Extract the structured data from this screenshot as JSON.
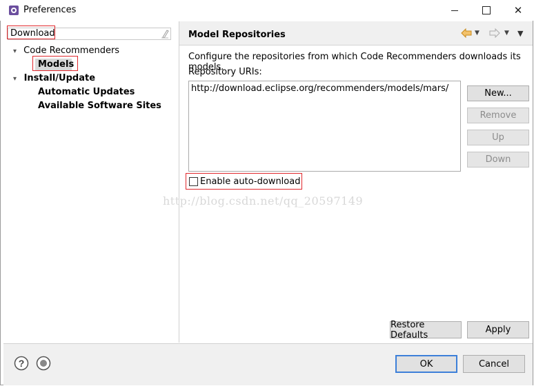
{
  "window": {
    "title": "Preferences"
  },
  "filter": {
    "value": "Download"
  },
  "tree": {
    "items": [
      {
        "label": "Code Recommenders",
        "twisty": "▾"
      },
      {
        "label": "Models"
      },
      {
        "label": "Install/Update",
        "twisty": "▾"
      },
      {
        "label": "Automatic Updates"
      },
      {
        "label": "Available Software Sites"
      }
    ]
  },
  "page": {
    "title": "Model Repositories",
    "description": "Configure the repositories from which Code Recommenders downloads its models.",
    "uris_label": "Repository URIs:",
    "uris": [
      "http://download.eclipse.org/recommenders/models/mars/"
    ],
    "buttons": {
      "new": "New...",
      "remove": "Remove",
      "up": "Up",
      "down": "Down"
    },
    "auto_download_label": "Enable auto-download",
    "auto_download_checked": false,
    "restore_defaults": "Restore Defaults",
    "apply": "Apply"
  },
  "watermark": "http://blog.csdn.net/qq_20597149",
  "dialog": {
    "ok": "OK",
    "cancel": "Cancel"
  },
  "icons": {
    "app": "eclipse-preferences-icon",
    "clear": "eraser-icon",
    "back": "back-arrow-icon",
    "forward": "forward-arrow-icon",
    "help": "help-icon",
    "import_export": "import-export-icon"
  },
  "colors": {
    "highlight_border": "#e0262b",
    "ok_border": "#3c7fd9",
    "arrow_orange": "#e8a33a"
  }
}
